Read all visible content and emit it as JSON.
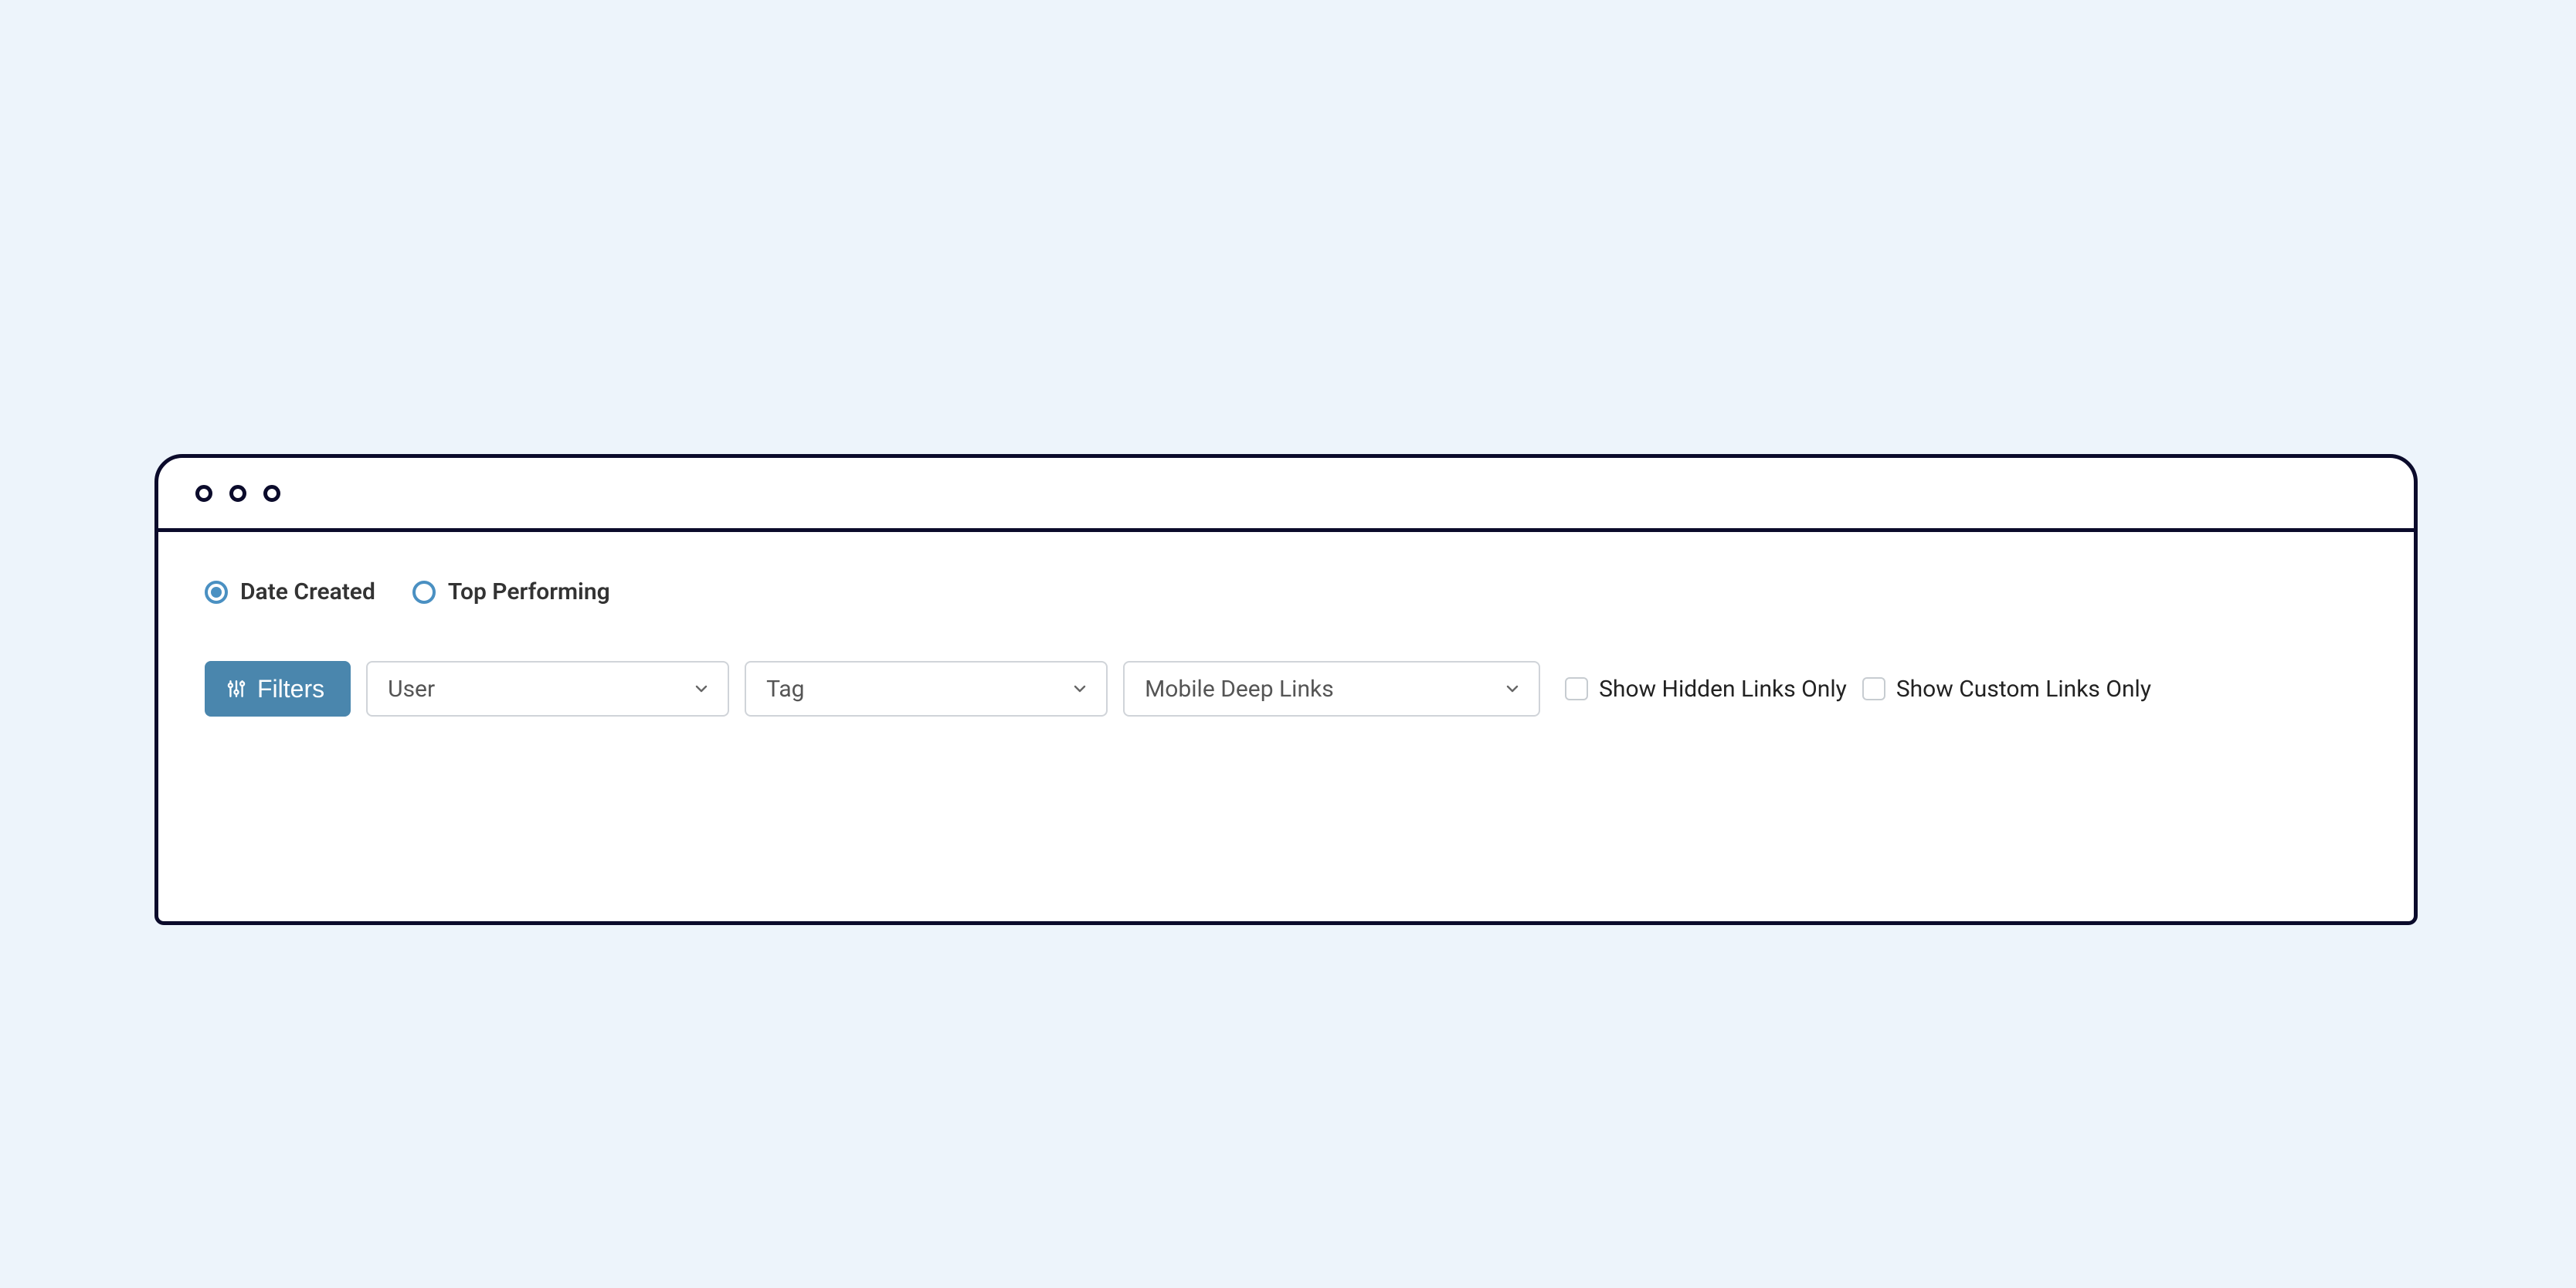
{
  "sort": {
    "options": [
      {
        "id": "date-created",
        "label": "Date Created",
        "selected": true
      },
      {
        "id": "top-performing",
        "label": "Top Performing",
        "selected": false
      }
    ]
  },
  "filters": {
    "button_label": "Filters",
    "dropdowns": {
      "user": {
        "label": "User"
      },
      "tag": {
        "label": "Tag"
      },
      "deep": {
        "label": "Mobile Deep Links"
      }
    },
    "checkboxes": {
      "hidden": {
        "label": "Show Hidden Links Only",
        "checked": false
      },
      "custom": {
        "label": "Show Custom Links Only",
        "checked": false
      }
    }
  }
}
